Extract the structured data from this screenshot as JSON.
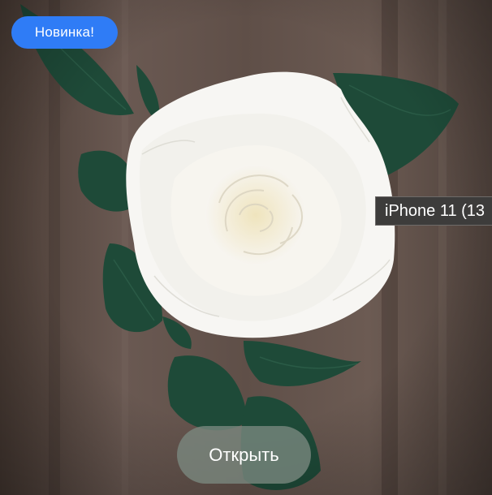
{
  "badge": {
    "label": "Новинка!",
    "color": "#2f7cf6"
  },
  "device_tooltip": {
    "label": "iPhone 11 (13"
  },
  "open_button": {
    "label": "Открыть"
  },
  "photo": {
    "background_color": "#5b4b43",
    "leaf_color": "#1e4a38",
    "rose_color": "#f5f3ee"
  }
}
